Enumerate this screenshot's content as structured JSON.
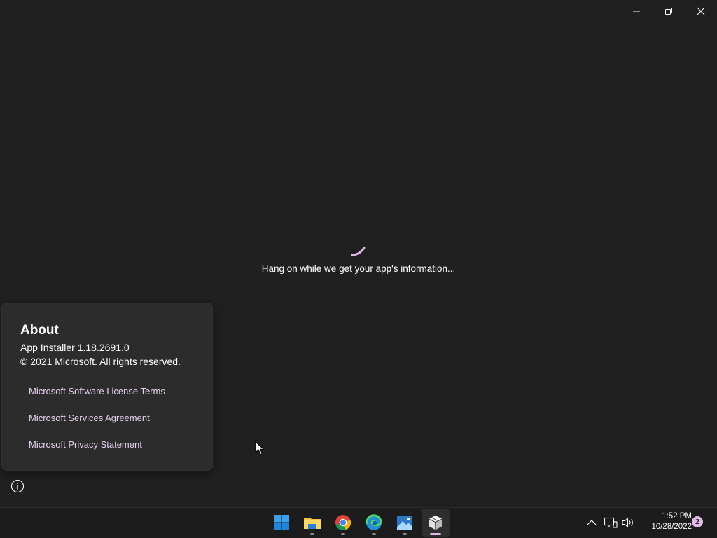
{
  "window": {
    "loading_text": "Hang on while we get your app's information...",
    "accent_color": "#e2b8e8"
  },
  "about": {
    "title": "About",
    "version": "App Installer 1.18.2691.0",
    "copyright": "© 2021 Microsoft. All rights reserved.",
    "links": [
      "Microsoft Software License Terms",
      "Microsoft Services Agreement",
      "Microsoft Privacy Statement"
    ]
  },
  "taskbar": {
    "apps": [
      "start-icon",
      "file-explorer-icon",
      "chrome-icon",
      "edge-icon",
      "photos-icon",
      "app-installer-icon"
    ],
    "time": "1:52 PM",
    "date": "10/28/2022",
    "notification_count": "2"
  }
}
